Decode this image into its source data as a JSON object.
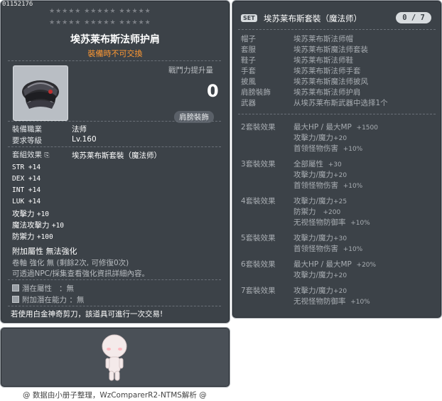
{
  "item": {
    "id": "01152176",
    "name": "埃苏莱布斯法师护肩",
    "trade": "裝備時不可交換",
    "power_label": "戰鬥力提升量",
    "power_value": "0",
    "category_badge": "肩膀裝飾",
    "job_label": "裝備職業",
    "job_value": "法师",
    "level_label": "要求等級",
    "level_value": "Lv.160",
    "set_label": "套組效果",
    "set_value": "埃苏莱布斯套裝（魔法师）",
    "stats": [
      {
        "label": "STR",
        "value": "+14"
      },
      {
        "label": "DEX",
        "value": "+14"
      },
      {
        "label": "INT",
        "value": "+14"
      },
      {
        "label": "LUK",
        "value": "+14"
      },
      {
        "label": "攻擊力",
        "value": "+10"
      },
      {
        "label": "魔法攻擊力",
        "value": "+10"
      },
      {
        "label": "防禦力",
        "value": "+100"
      }
    ],
    "extra_attr": "附加屬性 無法強化",
    "scroll_line": "卷軸 強化 無 (剩餘2次, 可修復0次)",
    "npc_line": "可透過NPC/採集查看強化資訊詳細內容。",
    "potential_label": "潛在屬性",
    "potential_value": "：無",
    "bonus_potential_label": "附加潛在能力",
    "bonus_potential_value": "：無",
    "scissors_line": "若使用白金神奇剪刀，該道具可進行一次交易!"
  },
  "set": {
    "badge": "SET",
    "title": "埃苏莱布斯套裝（魔法师）",
    "count": "0 / 7",
    "pieces": [
      {
        "slot": "帽子",
        "name": "埃苏莱布斯法师帽"
      },
      {
        "slot": "套服",
        "name": "埃苏莱布斯魔法师套装"
      },
      {
        "slot": "鞋子",
        "name": "埃苏莱布斯法师鞋"
      },
      {
        "slot": "手套",
        "name": "埃苏莱布斯法师手套"
      },
      {
        "slot": "披風",
        "name": "埃苏莱布斯魔法师披风"
      },
      {
        "slot": "肩膀裝飾",
        "name": "埃苏莱布斯法师护肩"
      },
      {
        "slot": "武器",
        "name": "从埃苏莱布斯武器中选择1个"
      }
    ],
    "effects": [
      {
        "head": "2套裝效果",
        "lines": [
          {
            "label": "最大HP / 最大MP",
            "value": "+1500"
          },
          {
            "label": "攻擊力/魔力",
            "value": "+20"
          },
          {
            "label": "首领怪物伤害",
            "value": "+10%"
          }
        ]
      },
      {
        "head": "3套裝效果",
        "lines": [
          {
            "label": "全部屬性",
            "value": "+30"
          },
          {
            "label": "攻擊力/魔力",
            "value": "+20"
          },
          {
            "label": "首领怪物伤害",
            "value": "+10%"
          }
        ]
      },
      {
        "head": "4套裝效果",
        "lines": [
          {
            "label": "攻擊力/魔力",
            "value": "+25"
          },
          {
            "label": "防禦力",
            "value": "+200"
          },
          {
            "label": "无视怪物防御率",
            "value": "+10%"
          }
        ]
      },
      {
        "head": "5套裝效果",
        "lines": [
          {
            "label": "攻擊力/魔力",
            "value": "+30"
          },
          {
            "label": "首领怪物伤害",
            "value": "+10%"
          }
        ]
      },
      {
        "head": "6套裝效果",
        "lines": [
          {
            "label": "最大HP / 最大MP",
            "value": "+20%"
          },
          {
            "label": "攻擊力/魔力",
            "value": "+20"
          }
        ]
      },
      {
        "head": "7套裝效果",
        "lines": [
          {
            "label": "攻擊力/魔力",
            "value": "+20"
          },
          {
            "label": "无视怪物防御率",
            "value": "+10%"
          }
        ]
      }
    ]
  },
  "footer": "@ 数据由小册子整理，WzComparerR2-NTMS解析 @",
  "colors": {
    "panel": "#3c4248",
    "trade": "#ff9933",
    "inactive": "#a8adb2"
  },
  "icons": [
    "shoulder-item-icon",
    "star-icon",
    "checkbox-icon",
    "character-avatar"
  ]
}
